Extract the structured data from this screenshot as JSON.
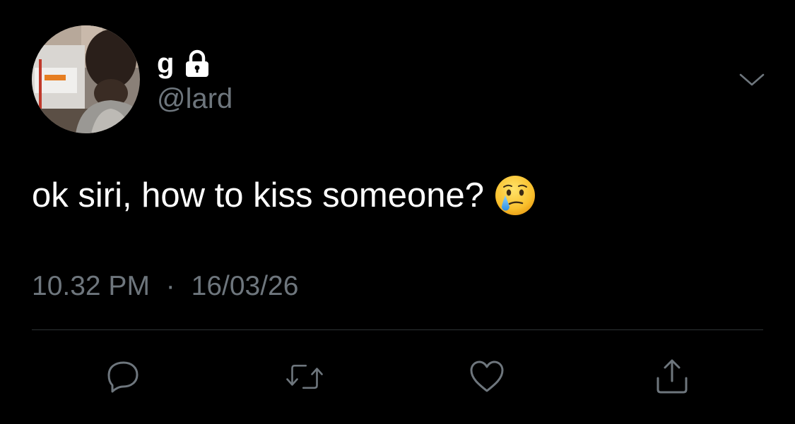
{
  "tweet": {
    "display_name": "g",
    "handle": "@lard",
    "text": "ok siri, how to kiss someone?",
    "time": "10.32 PM",
    "separator": "·",
    "date": "16/03/26",
    "protected": true,
    "emoji": "face-holding-back-tears-icon"
  },
  "icons": {
    "header": [
      "lock-icon",
      "chevron-down-icon"
    ],
    "actions": [
      "reply-icon",
      "retweet-icon",
      "like-icon",
      "share-icon"
    ]
  },
  "colors": {
    "background": "#000000",
    "primary_text": "#ffffff",
    "secondary_text": "#6e767d",
    "divider": "#2f3336",
    "icon": "#6e767d"
  }
}
